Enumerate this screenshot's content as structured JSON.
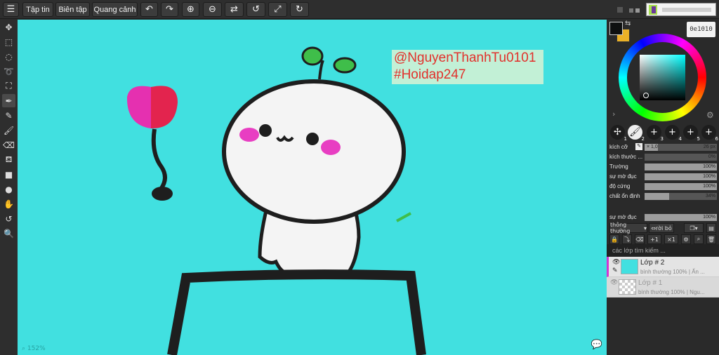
{
  "toolbar": {
    "menu_icon": "menu-icon",
    "file": "Tập tin",
    "edit": "Biên tập",
    "view": "Quang cảnh"
  },
  "canvas": {
    "background": "#41e0e0",
    "zoom": "152%",
    "annotation_line1": "@NguyenThanhTu0101",
    "annotation_line2": "#Hoidap247",
    "annotation_color": "#e2302b",
    "annotation_bg": "#c2f0d6"
  },
  "colors": {
    "primary": "#0e1010",
    "secondary": "#eab127",
    "hex": "0e1010"
  },
  "presets": [
    "1",
    "2",
    "3",
    "4",
    "5",
    "6"
  ],
  "brush": {
    "size_label": "kích cỡ",
    "size_scale": "× 1,0",
    "size_value": "26 px",
    "size_fraction": 0.18,
    "params": [
      {
        "label": "kích thước ...",
        "value": "0%",
        "fraction": 0.0
      },
      {
        "label": "Trường",
        "value": "100%",
        "fraction": 1.0
      },
      {
        "label": "sự mờ đục",
        "value": "100%",
        "fraction": 1.0
      },
      {
        "label": "độ cứng",
        "value": "100%",
        "fraction": 1.0
      },
      {
        "label": "chất ổn định",
        "value": "34%",
        "fraction": 0.34
      }
    ]
  },
  "layers_panel": {
    "opacity_label": "sự mờ đục",
    "opacity_value": "100%",
    "blend_mode": "thông thường",
    "clip_label": "rời bỏ",
    "search_placeholder": "các lớp tìm kiếm ...",
    "layers": [
      {
        "name": "Lớp # 2",
        "meta": "bình thường  100%  |  Ấn ..."
      },
      {
        "name": "Lớp # 1",
        "meta": "bình thường  100%  |  Ngu..."
      }
    ]
  }
}
